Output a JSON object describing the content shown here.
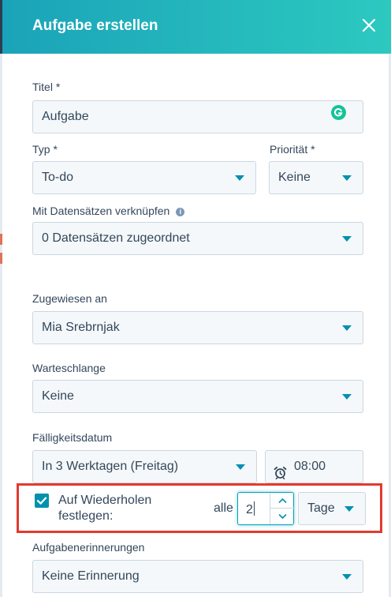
{
  "header": {
    "title": "Aufgabe erstellen"
  },
  "form": {
    "title_label": "Titel *",
    "title_value": "Aufgabe",
    "type_label": "Typ *",
    "type_value": "To-do",
    "priority_label": "Priorität *",
    "priority_value": "Keine",
    "link_label": "Mit Datensätzen verknüpfen",
    "link_value": "0 Datensätzen zugeordnet",
    "assigned_label": "Zugewiesen an",
    "assigned_value": "Mia Srebrnjak",
    "queue_label": "Warteschlange",
    "queue_value": "Keine",
    "due_label": "Fälligkeitsdatum",
    "due_value": "In 3 Werktagen (Freitag)",
    "time_value": "08:00",
    "recurring_label": "Auf Wiederholen festlegen:",
    "recurring_checked": true,
    "every_label": "alle",
    "interval_value": "2",
    "interval_unit": "Tage",
    "reminder_label": "Aufgabenerinnerungen",
    "reminder_value": "Keine Erinnerung"
  },
  "colors": {
    "header_start": "#1ba3b9",
    "header_end": "#2cc9c0",
    "accent": "#0091ae",
    "highlight_border": "#e23a2e"
  }
}
